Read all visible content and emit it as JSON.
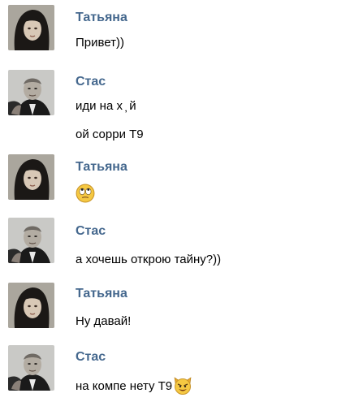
{
  "messages": [
    {
      "author": "Татьяна",
      "avatar": "tatyana-avatar",
      "lines": [
        "Привет))"
      ]
    },
    {
      "author": "Стас",
      "avatar": "stas-avatar",
      "lines": [
        "иди на х ̦ й",
        "ой сорри Т9"
      ]
    },
    {
      "author": "Татьяна",
      "avatar": "tatyana-avatar",
      "emoji": "rolling-eyes-emoji"
    },
    {
      "author": "Стас",
      "avatar": "stas-avatar",
      "lines": [
        "а хочешь открою тайну?))"
      ]
    },
    {
      "author": "Татьяна",
      "avatar": "tatyana-avatar",
      "lines": [
        "Ну давай!"
      ]
    },
    {
      "author": "Стас",
      "avatar": "stas-avatar",
      "lines": [
        "на компе нету Т9"
      ],
      "trailing_emoji": "devil-smile-emoji"
    }
  ],
  "colors": {
    "author_name": "#45688e",
    "text": "#000000",
    "background": "#ffffff"
  }
}
